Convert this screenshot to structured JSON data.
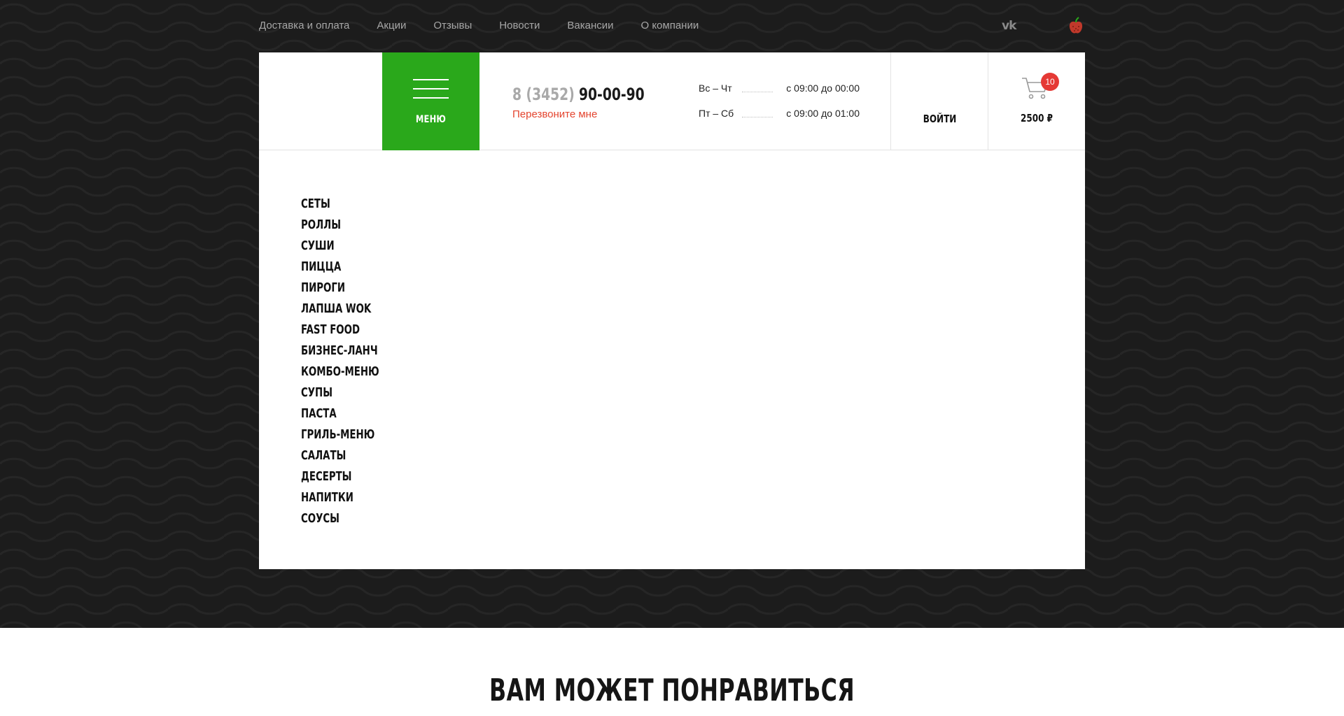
{
  "topnav": {
    "links": [
      "Доставка и оплата",
      "Акции",
      "Отзывы",
      "Новости",
      "Вакансии",
      "О компании"
    ]
  },
  "social": {
    "vk_icon": "vk-icon",
    "apple_icon": "apple-icon"
  },
  "header": {
    "menu_label": "МЕНЮ",
    "phone_code": "8 (3452)",
    "phone_number": "90-00-90",
    "callback_label": "Перезвоните мне",
    "hours": [
      {
        "day": "Вс – Чт",
        "time": "с 09:00 до 00:00"
      },
      {
        "day": "Пт – Сб",
        "time": "с 09:00 до 01:00"
      }
    ],
    "login_label": "ВОЙТИ",
    "cart_count": "10",
    "cart_total": "2500 ₽"
  },
  "categories": [
    "СЕТЫ",
    "РОЛЛЫ",
    "СУШИ",
    "ПИЦЦА",
    "ПИРОГИ",
    "ЛАПША WOK",
    "FAST FOOD",
    "БИЗНЕС-ЛАНЧ",
    "КОМБО-МЕНЮ",
    "СУПЫ",
    "ПАСТА",
    "ГРИЛЬ-МЕНЮ",
    "САЛАТЫ",
    "ДЕСЕРТЫ",
    "НАПИТКИ",
    "СОУСЫ"
  ],
  "section_title": "ВАМ МОЖЕТ ПОНРАВИТЬСЯ",
  "colors": {
    "accent_green": "#2aa81b",
    "callback_red": "#e4442e",
    "badge_red": "#e53935",
    "background_dark": "#1c1c1c"
  }
}
